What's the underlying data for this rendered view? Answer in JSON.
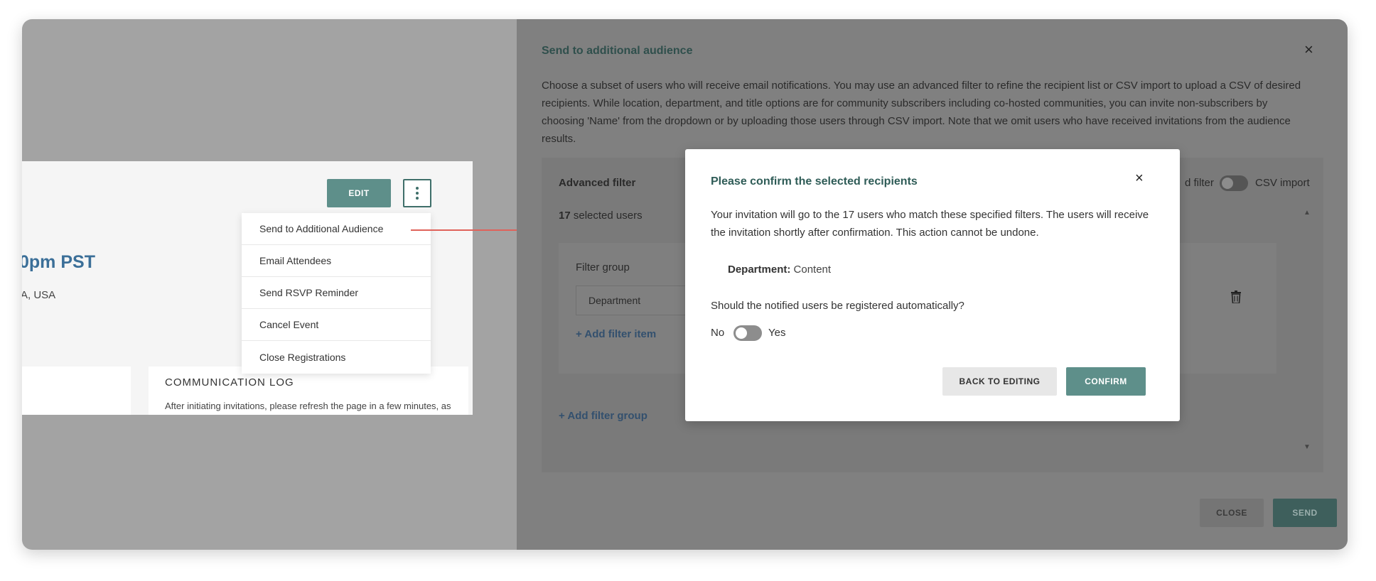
{
  "event_page": {
    "edit_label": "EDIT",
    "event_time": "0pm PST",
    "location": "A, USA",
    "comm_log": {
      "title": "COMMUNICATION LOG",
      "text": "After initiating invitations, please refresh the page in a few minutes, as"
    },
    "menu": [
      {
        "label": "Send to Additional Audience"
      },
      {
        "label": "Email Attendees"
      },
      {
        "label": "Send RSVP Reminder"
      },
      {
        "label": "Cancel Event"
      },
      {
        "label": "Close Registrations"
      }
    ]
  },
  "drawer": {
    "title": "Send to additional audience",
    "close_icon": "×",
    "description": "Choose a subset of users who will receive email notifications. You may use an advanced filter to refine the recipient list or CSV import to upload a CSV of desired recipients. While location, department, and title options are for community subscribers including co-hosted communities, you can invite non-subscribers by choosing 'Name' from the dropdown or by uploading those users through CSV import. Note that we omit users who have received invitations from the audience results.",
    "advanced_filter_label": "Advanced filter",
    "advanced_filter_toggle_label": "d filter",
    "csv_import_label": "CSV import",
    "selected_count": "17",
    "selected_suffix": "selected users",
    "filter_group_label": "Filter group",
    "filter_field_value": "Department",
    "add_filter_item": "+ Add filter item",
    "add_filter_group": "+ Add filter group",
    "close_label": "CLOSE",
    "send_label": "SEND"
  },
  "modal": {
    "title": "Please confirm the selected recipients",
    "close_icon": "×",
    "body": "Your invitation will go to the 17 users who match these specified filters. The users will receive the invitation shortly after confirmation. This action cannot be undone.",
    "filter_key": "Department:",
    "filter_value": "Content",
    "auto_register_question": "Should the notified users be registered automatically?",
    "no_label": "No",
    "yes_label": "Yes",
    "auto_register": false,
    "back_label": "BACK TO EDITING",
    "confirm_label": "CONFIRM"
  },
  "colors": {
    "accent": "#5e8f8a",
    "link": "#3b6f98",
    "arrow": "#e0625a"
  }
}
